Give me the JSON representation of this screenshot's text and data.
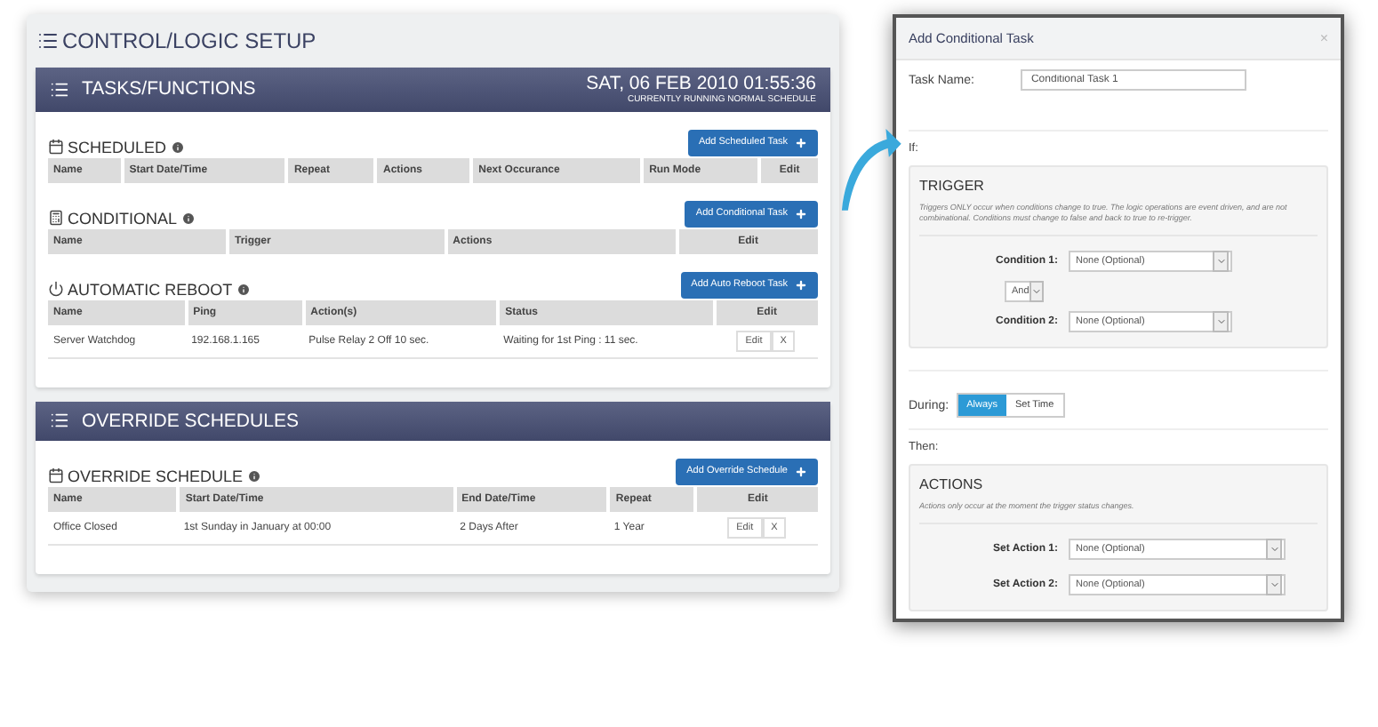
{
  "page_title": "CONTROL/LOGIC SETUP",
  "panels": [
    {
      "title": "TASKS/FUNCTIONS",
      "datetime": "SAT, 06 FEB 2010 01:55:36",
      "status": "CURRENTLY RUNNING NORMAL SCHEDULE",
      "sections": [
        {
          "kind": "calendar",
          "title": "SCHEDULED",
          "button": "Add Scheduled Task",
          "columns": [
            "Name",
            "Start Date/Time",
            "Repeat",
            "Actions",
            "Next Occurance",
            "Run Mode",
            "Edit"
          ]
        },
        {
          "kind": "grid",
          "title": "CONDITIONAL",
          "button": "Add Conditional Task",
          "columns": [
            "Name",
            "Trigger",
            "Actions",
            "Edit"
          ]
        },
        {
          "kind": "power",
          "title": "AUTOMATIC REBOOT",
          "button": "Add Auto Reboot Task",
          "columns": [
            "Name",
            "Ping",
            "Action(s)",
            "Status",
            "Edit"
          ],
          "rows": [
            {
              "cells": [
                "Server Watchdog",
                "192.168.1.165",
                "Pulse Relay 2 Off 10 sec.",
                "Waiting for 1st Ping : 11 sec."
              ],
              "buttons": [
                "Edit",
                "X"
              ]
            }
          ]
        }
      ]
    },
    {
      "title": "OVERRIDE SCHEDULES",
      "sections": [
        {
          "kind": "calendar",
          "title": "OVERRIDE SCHEDULE",
          "button": "Add Override Schedule",
          "columns": [
            "Name",
            "Start Date/Time",
            "End Date/Time",
            "Repeat",
            "Edit"
          ],
          "rows": [
            {
              "cells": [
                "Office Closed",
                "1st Sunday in January at 00:00",
                "2 Days After",
                "1 Year"
              ],
              "buttons": [
                "Edit",
                "X"
              ]
            }
          ]
        }
      ]
    }
  ],
  "modal": {
    "title": "Add Conditional Task",
    "close": "×",
    "task_name_label": "Task Name:",
    "task_name_value": "Conditional Task 1",
    "if_label": "If:",
    "trigger": {
      "title": "TRIGGER",
      "description": "Triggers ONLY occur when conditions change to true. The logic operations are event driven, and are not combinational. Conditions must change to false and back to true to re-trigger.",
      "condition_1_label": "Condition 1:",
      "condition_1_value": "None (Optional)",
      "operator": "And",
      "condition_2_label": "Condition 2:",
      "condition_2_value": "None (Optional)"
    },
    "during_label": "During:",
    "during_options": [
      {
        "label": "Always",
        "selected": true
      },
      {
        "label": "Set Time",
        "selected": false
      }
    ],
    "then_label": "Then:",
    "actions": {
      "title": "ACTIONS",
      "description": "Actions only occur at the moment the trigger status changes.",
      "items": [
        {
          "label": "Set Action 1:",
          "value": "None (Optional)"
        },
        {
          "label": "Set Action 2:",
          "value": "None (Optional)"
        }
      ]
    }
  }
}
